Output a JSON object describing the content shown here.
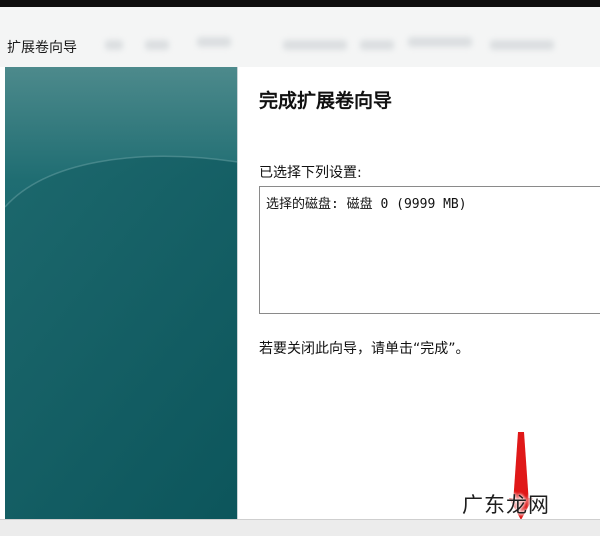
{
  "window": {
    "title": "扩展卷向导"
  },
  "wizard": {
    "heading": "完成扩展卷向导",
    "settings_label": "已选择下列设置:",
    "settings_list": [
      "选择的磁盘: 磁盘 0 (9999 MB)"
    ],
    "close_instruction": "若要关闭此向导，请单击“完成”。"
  },
  "watermark": {
    "text": "广东龙网"
  },
  "colors": {
    "sidebar_light": "#4d8a8c",
    "sidebar_dark": "#0e5a60",
    "annotation_arrow": "#e01818"
  },
  "icons": [
    "annotation-arrow-icon"
  ]
}
